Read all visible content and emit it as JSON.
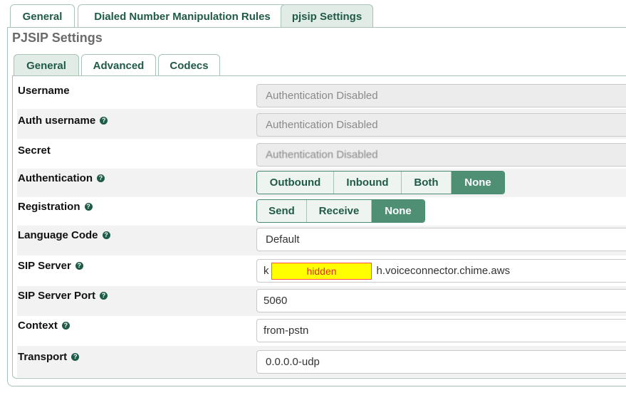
{
  "top_tabs": [
    {
      "label": "General",
      "active": false
    },
    {
      "label": "Dialed Number Manipulation Rules",
      "active": false
    },
    {
      "label": "pjsip Settings",
      "active": true
    }
  ],
  "panel_title": "PJSIP Settings",
  "sub_tabs": [
    {
      "label": "General",
      "active": true
    },
    {
      "label": "Advanced",
      "active": false
    },
    {
      "label": "Codecs",
      "active": false
    }
  ],
  "fields": {
    "username": {
      "label": "Username",
      "value": "Authentication Disabled"
    },
    "auth_username": {
      "label": "Auth username",
      "value": "Authentication Disabled"
    },
    "secret": {
      "label": "Secret",
      "value": "Authentication Disabled"
    },
    "authentication": {
      "label": "Authentication",
      "options": [
        "Outbound",
        "Inbound",
        "Both",
        "None"
      ],
      "selected": "None"
    },
    "registration": {
      "label": "Registration",
      "options": [
        "Send",
        "Receive",
        "None"
      ],
      "selected": "None"
    },
    "language_code": {
      "label": "Language Code",
      "value": "Default"
    },
    "sip_server": {
      "label": "SIP Server",
      "value_prefix": "k",
      "redaction_label": "hidden",
      "value_suffix": "h.voiceconnector.chime.aws"
    },
    "sip_server_port": {
      "label": "SIP Server Port",
      "value": "5060"
    },
    "context": {
      "label": "Context",
      "value": "from-pstn"
    },
    "transport": {
      "label": "Transport",
      "value": "0.0.0.0-udp"
    }
  },
  "icons": {
    "help": "question-circle-icon"
  },
  "colors": {
    "accent": "#4f8f74",
    "tab_text": "#1f5a48",
    "redaction": "#ffff00"
  }
}
